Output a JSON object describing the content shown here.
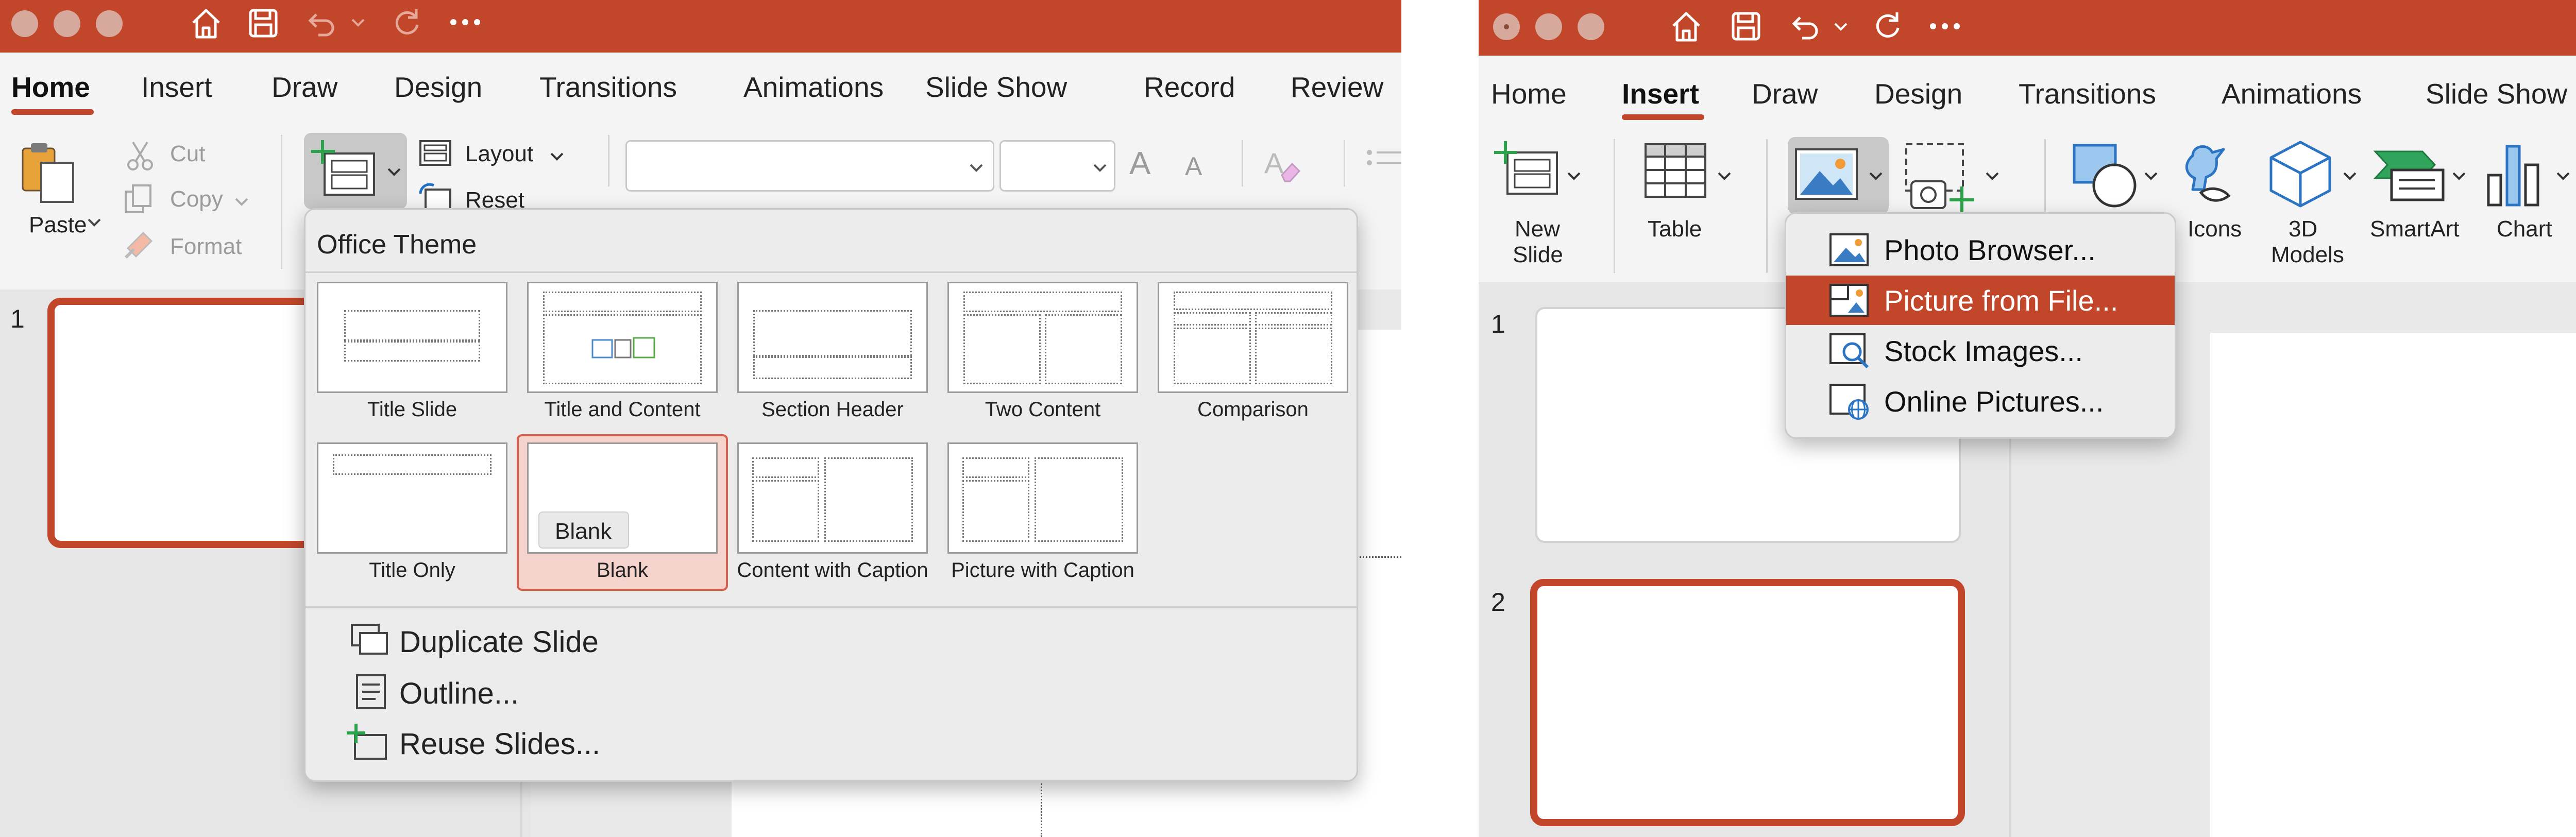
{
  "colors": {
    "accent": "#c2472a",
    "accent_light": "#f3d3cc",
    "ribbon_bg": "#f4f4f4",
    "panel_bg": "#e9e9e9"
  },
  "left": {
    "tabs": [
      "Home",
      "Insert",
      "Draw",
      "Design",
      "Transitions",
      "Animations",
      "Slide Show",
      "Record",
      "Review"
    ],
    "active_tab": "Home",
    "clipboard": {
      "paste": "Paste",
      "cut": "Cut",
      "copy": "Copy",
      "format": "Format"
    },
    "slide_group": {
      "layout": "Layout",
      "reset": "Reset"
    },
    "font_controls": {
      "grow": "A",
      "shrink": "A"
    },
    "slide_number": "1",
    "new_slide_menu": {
      "header": "Office Theme",
      "layouts": [
        {
          "name": "Title Slide"
        },
        {
          "name": "Title and Content"
        },
        {
          "name": "Section Header"
        },
        {
          "name": "Two Content"
        },
        {
          "name": "Comparison"
        },
        {
          "name": "Title Only"
        },
        {
          "name": "Blank",
          "selected": true
        },
        {
          "name": "Content with Caption"
        },
        {
          "name": "Picture with Caption"
        }
      ],
      "tooltip": "Blank",
      "actions": [
        {
          "label": "Duplicate Slide",
          "icon": "duplicate-slide-icon"
        },
        {
          "label": "Outline...",
          "icon": "outline-icon"
        },
        {
          "label": "Reuse Slides...",
          "icon": "reuse-slides-icon"
        }
      ]
    }
  },
  "right": {
    "tabs": [
      "Home",
      "Insert",
      "Draw",
      "Design",
      "Transitions",
      "Animations",
      "Slide Show"
    ],
    "active_tab": "Insert",
    "buttons": {
      "new_slide": [
        "New",
        "Slide"
      ],
      "table": "Table",
      "icons": "Icons",
      "models": [
        "3D",
        "Models"
      ],
      "smartart": "SmartArt",
      "chart": "Chart"
    },
    "slide_numbers": [
      "1",
      "2"
    ],
    "pictures_menu": [
      {
        "label": "Photo Browser...",
        "icon": "photo-browser-icon"
      },
      {
        "label": "Picture from File...",
        "icon": "picture-from-file-icon",
        "highlighted": true
      },
      {
        "label": "Stock Images...",
        "icon": "stock-images-icon"
      },
      {
        "label": "Online Pictures...",
        "icon": "online-pictures-icon"
      }
    ]
  }
}
